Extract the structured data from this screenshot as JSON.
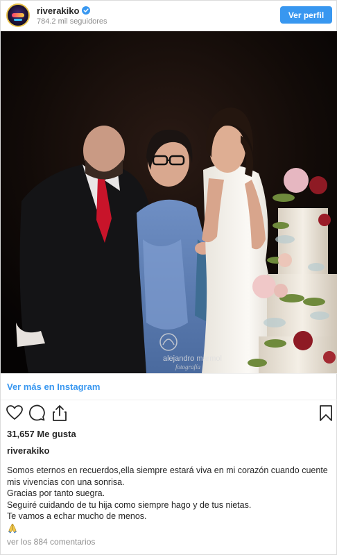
{
  "header": {
    "username": "riverakiko",
    "followers": "784.2 mil seguidores",
    "profile_button": "Ver perfil"
  },
  "photo": {
    "watermark_main": "alejandro marmol",
    "watermark_sub": "fotografía"
  },
  "links": {
    "view_more": "Ver más en Instagram"
  },
  "icons": {
    "like": "heart-icon",
    "comment": "comment-icon",
    "share": "share-icon",
    "save": "bookmark-icon"
  },
  "post": {
    "likes": "31,657 Me gusta",
    "caption_user": "riverakiko",
    "caption_lines": [
      "Somos eternos en recuerdos,ella siempre estará viva en mi corazón cuando cuente",
      "mis vivencias con una sonrisa.",
      "Gracias por tanto suegra.",
      "Seguiré cuidando de tu hija como siempre hago y de tus nietas.",
      "Te vamos a echar mucho de menos."
    ],
    "comments_link": "ver los 884 comentarios"
  },
  "colors": {
    "accent": "#3897f0",
    "text": "#262626",
    "muted": "#8e8e8e"
  }
}
